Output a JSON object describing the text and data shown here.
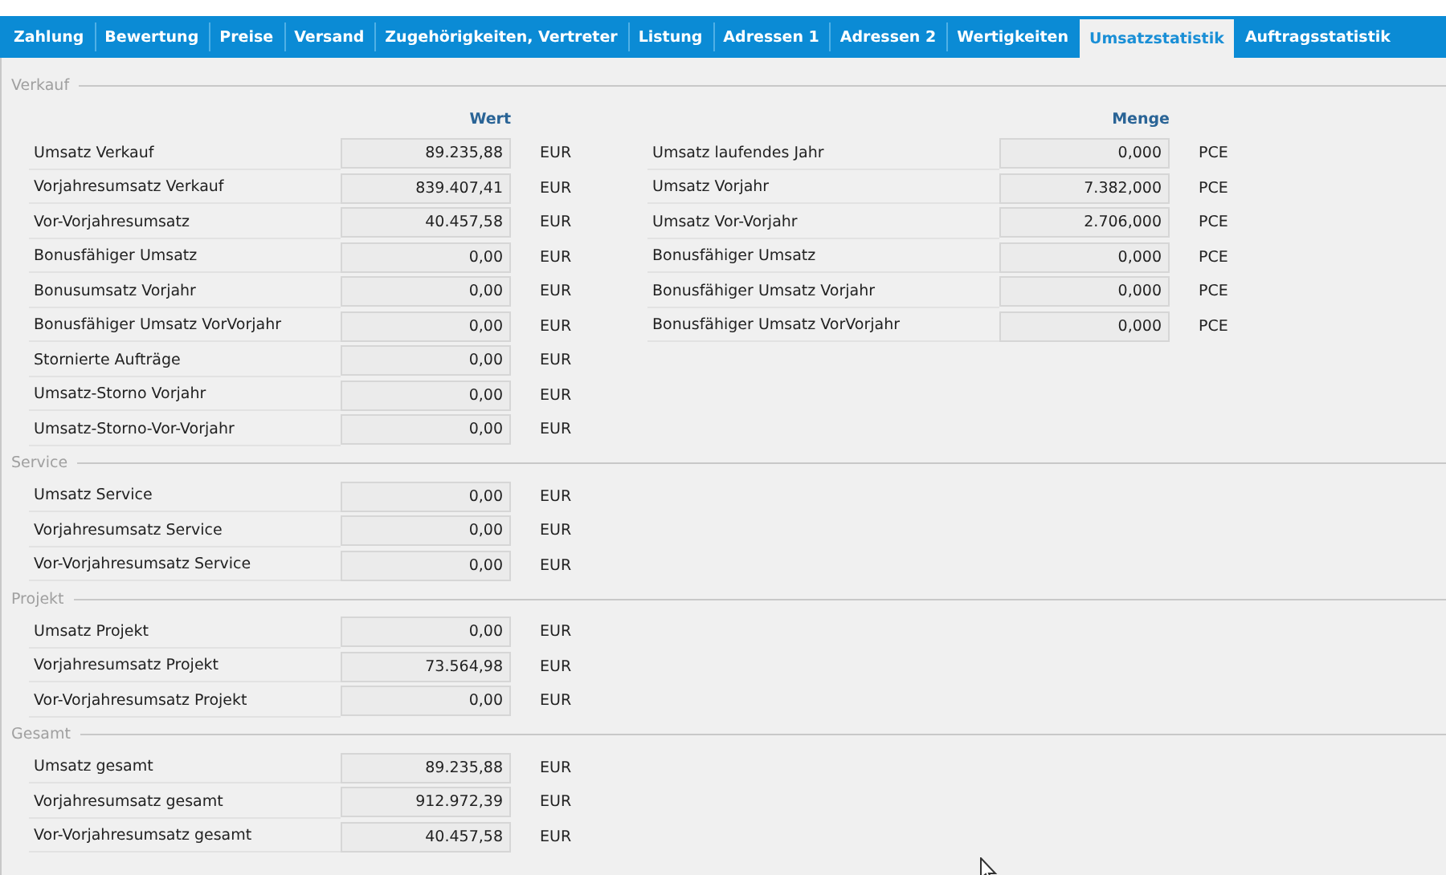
{
  "tabs": [
    {
      "label": "Zahlung",
      "selected": false
    },
    {
      "label": "Bewertung",
      "selected": false
    },
    {
      "label": "Preise",
      "selected": false
    },
    {
      "label": "Versand",
      "selected": false
    },
    {
      "label": "Zugehörigkeiten, Vertreter",
      "selected": false
    },
    {
      "label": "Listung",
      "selected": false
    },
    {
      "label": "Adressen 1",
      "selected": false
    },
    {
      "label": "Adressen 2",
      "selected": false
    },
    {
      "label": "Wertigkeiten",
      "selected": false
    },
    {
      "label": "Umsatzstatistik",
      "selected": true
    },
    {
      "label": "Auftragsstatistik",
      "selected": false
    }
  ],
  "sections": [
    {
      "title": "Verkauf",
      "columns": [
        {
          "header": "Wert",
          "rows": [
            {
              "label": "Umsatz Verkauf",
              "value": "89.235,88",
              "unit": "EUR"
            },
            {
              "label": "Vorjahresumsatz Verkauf",
              "value": "839.407,41",
              "unit": "EUR"
            },
            {
              "label": "Vor-Vorjahresumsatz",
              "value": "40.457,58",
              "unit": "EUR"
            },
            {
              "label": "Bonusfähiger Umsatz",
              "value": "0,00",
              "unit": "EUR"
            },
            {
              "label": "Bonusumsatz Vorjahr",
              "value": "0,00",
              "unit": "EUR"
            },
            {
              "label": "Bonusfähiger Umsatz VorVorjahr",
              "value": "0,00",
              "unit": "EUR"
            },
            {
              "label": "Stornierte Aufträge",
              "value": "0,00",
              "unit": "EUR"
            },
            {
              "label": "Umsatz-Storno Vorjahr",
              "value": "0,00",
              "unit": "EUR"
            },
            {
              "label": "Umsatz-Storno-Vor-Vorjahr",
              "value": "0,00",
              "unit": "EUR"
            }
          ]
        },
        {
          "header": "Menge",
          "rows": [
            {
              "label": "Umsatz laufendes Jahr",
              "value": "0,000",
              "unit": "PCE"
            },
            {
              "label": "Umsatz Vorjahr",
              "value": "7.382,000",
              "unit": "PCE"
            },
            {
              "label": "Umsatz Vor-Vorjahr",
              "value": "2.706,000",
              "unit": "PCE"
            },
            {
              "label": "Bonusfähiger Umsatz",
              "value": "0,000",
              "unit": "PCE"
            },
            {
              "label": "Bonusfähiger Umsatz Vorjahr",
              "value": "0,000",
              "unit": "PCE"
            },
            {
              "label": "Bonusfähiger Umsatz VorVorjahr",
              "value": "0,000",
              "unit": "PCE"
            }
          ]
        }
      ]
    },
    {
      "title": "Service",
      "columns": [
        {
          "rows": [
            {
              "label": "Umsatz Service",
              "value": "0,00",
              "unit": "EUR"
            },
            {
              "label": "Vorjahresumsatz Service",
              "value": "0,00",
              "unit": "EUR"
            },
            {
              "label": "Vor-Vorjahresumsatz Service",
              "value": "0,00",
              "unit": "EUR"
            }
          ]
        }
      ]
    },
    {
      "title": "Projekt",
      "columns": [
        {
          "rows": [
            {
              "label": "Umsatz Projekt",
              "value": "0,00",
              "unit": "EUR"
            },
            {
              "label": "Vorjahresumsatz Projekt",
              "value": "73.564,98",
              "unit": "EUR"
            },
            {
              "label": "Vor-Vorjahresumsatz Projekt",
              "value": "0,00",
              "unit": "EUR"
            }
          ]
        }
      ]
    },
    {
      "title": "Gesamt",
      "columns": [
        {
          "rows": [
            {
              "label": "Umsatz gesamt",
              "value": "89.235,88",
              "unit": "EUR"
            },
            {
              "label": "Vorjahresumsatz gesamt",
              "value": "912.972,39",
              "unit": "EUR"
            },
            {
              "label": "Vor-Vorjahresumsatz gesamt",
              "value": "40.457,58",
              "unit": "EUR"
            }
          ]
        }
      ]
    }
  ]
}
